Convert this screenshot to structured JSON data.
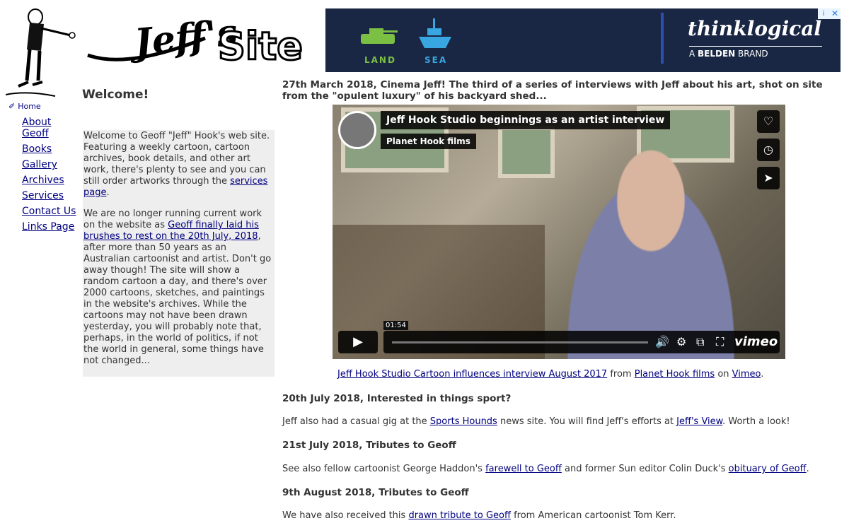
{
  "ad": {
    "land": "LAND",
    "sea": "SEA",
    "brand": "thinklogical",
    "tagline_prefix": "A ",
    "tagline_brand": "BELDEN",
    "tagline_suffix": " BRAND",
    "choices": "i",
    "close": "✕"
  },
  "nav": {
    "home": "Home",
    "items": [
      "About Geoff",
      "Books",
      "Gallery",
      "Archives",
      "Services",
      "Contact Us",
      "Links Page"
    ]
  },
  "welcome": {
    "title": "Welcome!",
    "p1_before": "Welcome to Geoff \"Jeff\" Hook's web site. Featuring a weekly cartoon, cartoon archives, book details, and other art work, there's plenty to see and you can still order artworks through the ",
    "p1_link": "services page",
    "p1_after": ".",
    "p2_before": "We are no longer running current work on the website as ",
    "p2_link": "Geoff finally laid his brushes to rest on the 20th July, 2018",
    "p2_after": ", after more than 50 years as an Australian cartoonist and artist. Don't go away though! The site will show a random cartoon a day, and there's over 2000 cartoons, sketches, and paintings in the website's archives. While the cartoons may not have been drawn yesterday, you will probably note that, perhaps, in the world of politics, if not the world in general, some things have not changed..."
  },
  "main": {
    "headline": "27th March 2018, Cinema Jeff! The third of a series of interviews with Jeff about his art, shot on site from the \"opulent luxury\" of his backyard shed...",
    "video": {
      "title": "Jeff Hook Studio beginnings as an artist interview",
      "channel": "Planet Hook films",
      "time": "01:54",
      "brand": "vimeo"
    },
    "caption": {
      "link1": "Jeff Hook Studio Cartoon influences interview August 2017",
      "from": " from ",
      "link2": "Planet Hook films",
      "on": " on ",
      "link3": "Vimeo",
      "end": "."
    },
    "s1_head": "20th July 2018, Interested in things sport?",
    "s1_before": "Jeff also had a casual gig at the ",
    "s1_link1": "Sports Hounds",
    "s1_mid": " news site. You will find Jeff's efforts at ",
    "s1_link2": "Jeff's View",
    "s1_after": ". Worth a look!",
    "s2_head": "21st July 2018, Tributes to Geoff",
    "s2_before": "See also fellow cartoonist George Haddon's ",
    "s2_link1": "farewell to Geoff",
    "s2_mid": " and former Sun editor Colin Duck's ",
    "s2_link2": "obituary of Geoff",
    "s2_after": ".",
    "s3_head": "9th August 2018, Tributes to Geoff",
    "s3_before": "We have also received this ",
    "s3_link": "drawn tribute to Geoff",
    "s3_after": " from American cartoonist Tom Kerr."
  }
}
